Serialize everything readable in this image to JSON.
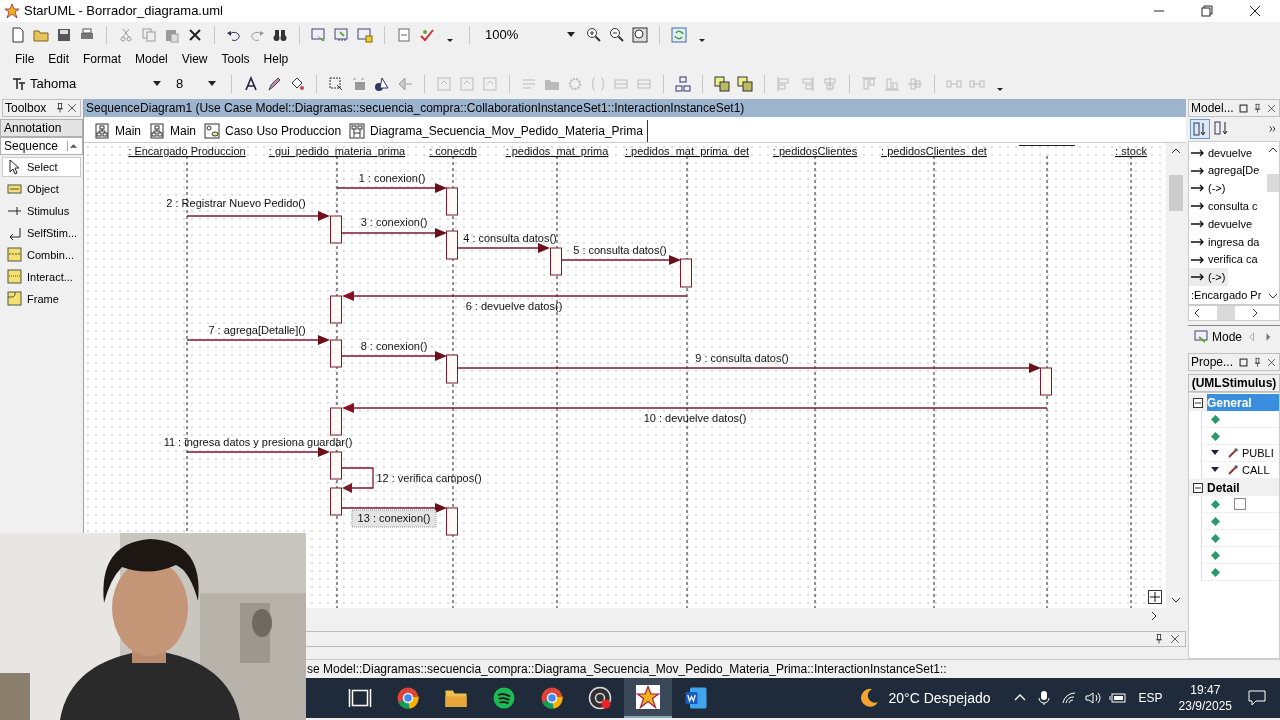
{
  "window": {
    "title": "StarUML - Borrador_diagrama.uml"
  },
  "zoom": {
    "value": "100%"
  },
  "menu": [
    "File",
    "Edit",
    "Format",
    "Model",
    "View",
    "Tools",
    "Help"
  ],
  "font_toolbar": {
    "font": "Tahoma",
    "size": "8"
  },
  "toolbox": {
    "title": "Toolbox",
    "groups": [
      {
        "label": "Annotation",
        "selected": false
      },
      {
        "label": "Sequence",
        "selected": true
      }
    ],
    "items": [
      {
        "label": "Select",
        "kind": "select",
        "selected": true
      },
      {
        "label": "Object",
        "kind": "object",
        "selected": false
      },
      {
        "label": "Stimulus",
        "kind": "stimulus",
        "selected": false
      },
      {
        "label": "SelfStim...",
        "kind": "self",
        "selected": false
      },
      {
        "label": "Combin...",
        "kind": "combined",
        "selected": false
      },
      {
        "label": "Interact...",
        "kind": "interaction",
        "selected": false
      },
      {
        "label": "Frame",
        "kind": "frame",
        "selected": false
      }
    ]
  },
  "diagram": {
    "title": "SequenceDiagram1 (Use Case Model::Diagramas::secuencia_compra::CollaborationInstanceSet1::InteractionInstanceSet1)",
    "tabs": [
      {
        "label": "Main",
        "kind": "class",
        "selected": false
      },
      {
        "label": "Main",
        "kind": "class",
        "selected": false
      },
      {
        "label": "Caso Uso Produccion",
        "kind": "usecase",
        "selected": false
      },
      {
        "label": "Diagrama_Secuencia_Mov_Pedido_Materia_Prima",
        "kind": "sequence",
        "selected": true
      }
    ],
    "lifelines": [
      {
        "name": ": Encargado Produccion"
      },
      {
        "name": ": gui_pedido_materia_prima"
      },
      {
        "name": ": conecdb"
      },
      {
        "name": ": pedidos_mat_prima"
      },
      {
        "name": ": pedidos_mat_prima_det"
      },
      {
        "name": ": pedidosClientes"
      },
      {
        "name": ": pedidosClientes_det"
      },
      {
        "kind": "unlabeled"
      },
      {
        "name": ": stock"
      }
    ],
    "messages": [
      {
        "label": "1 : conexion()",
        "kind": "call",
        "selected": false
      },
      {
        "label": "2 : Registrar Nuevo Pedido()",
        "kind": "call",
        "selected": false
      },
      {
        "label": "3 : conexion()",
        "kind": "call",
        "selected": false
      },
      {
        "label": "4 : consulta datos()",
        "kind": "call",
        "selected": false
      },
      {
        "label": "5 : consulta datos()",
        "kind": "call",
        "selected": false
      },
      {
        "label": "6 : devuelve datos()",
        "kind": "return",
        "selected": false
      },
      {
        "label": "7 : agrega[Detalle]()",
        "kind": "call",
        "selected": false
      },
      {
        "label": "8 : conexion()",
        "kind": "call",
        "selected": false
      },
      {
        "label": "9 : consulta datos()",
        "kind": "call",
        "selected": false
      },
      {
        "label": "10 : devuelve datos()",
        "kind": "return",
        "selected": false
      },
      {
        "label": "11 : ingresa datos y presiona guardar()",
        "kind": "call",
        "selected": false
      },
      {
        "label": "12 : verifica campos()",
        "kind": "self",
        "selected": false
      },
      {
        "label": "13 : conexion()",
        "kind": "call",
        "selected": true
      }
    ]
  },
  "model_explorer": {
    "title": "Model...",
    "items": [
      {
        "label": "devuelve",
        "kind": "stimulus",
        "selected": false
      },
      {
        "label": "agrega[De",
        "kind": "stimulus",
        "selected": false
      },
      {
        "label": "(->)",
        "kind": "stimulus",
        "selected": false
      },
      {
        "label": "consulta c",
        "kind": "stimulus",
        "selected": false
      },
      {
        "label": "devuelve",
        "kind": "stimulus",
        "selected": false
      },
      {
        "label": "ingresa da",
        "kind": "stimulus",
        "selected": false
      },
      {
        "label": "verifica ca",
        "kind": "stimulus",
        "selected": false
      },
      {
        "label": "(->)",
        "kind": "stimulus",
        "selected": true
      },
      {
        "label": ":Encargado Pr",
        "kind": "object",
        "selected": false
      }
    ],
    "tab": "Mode"
  },
  "properties": {
    "title": "Prope...",
    "subject": "(UMLStimulus)",
    "sections": [
      {
        "label": "General",
        "selected": true,
        "rows": [
          {
            "kind": "blank"
          },
          {
            "kind": "blank"
          },
          {
            "kind": "dropdown",
            "value": "PUBLI"
          },
          {
            "kind": "dropdown",
            "value": "CALL"
          }
        ]
      },
      {
        "label": "Detail",
        "selected": false,
        "rows": [
          {
            "kind": "checkbox",
            "checked": false
          },
          {
            "kind": "blank"
          },
          {
            "kind": "blank"
          },
          {
            "kind": "blank"
          },
          {
            "kind": "blank"
          }
        ]
      }
    ]
  },
  "status_bar": {
    "text": "se Model::Diagramas::secuencia_compra::Diagrama_Secuencia_Mov_Pedido_Materia_Prima::InteractionInstanceSet1::"
  },
  "taskbar": {
    "apps": [
      {
        "kind": "taskview",
        "selected": false
      },
      {
        "kind": "browser",
        "selected": false
      },
      {
        "kind": "folder",
        "selected": false
      },
      {
        "kind": "music",
        "selected": false
      },
      {
        "kind": "browser",
        "selected": false
      },
      {
        "kind": "recorder",
        "selected": false
      },
      {
        "kind": "star",
        "selected": true
      },
      {
        "kind": "document",
        "selected": false
      }
    ],
    "weather": "20°C Despejado",
    "language": "ESP",
    "time": "19:47",
    "date": "23/9/2025"
  }
}
